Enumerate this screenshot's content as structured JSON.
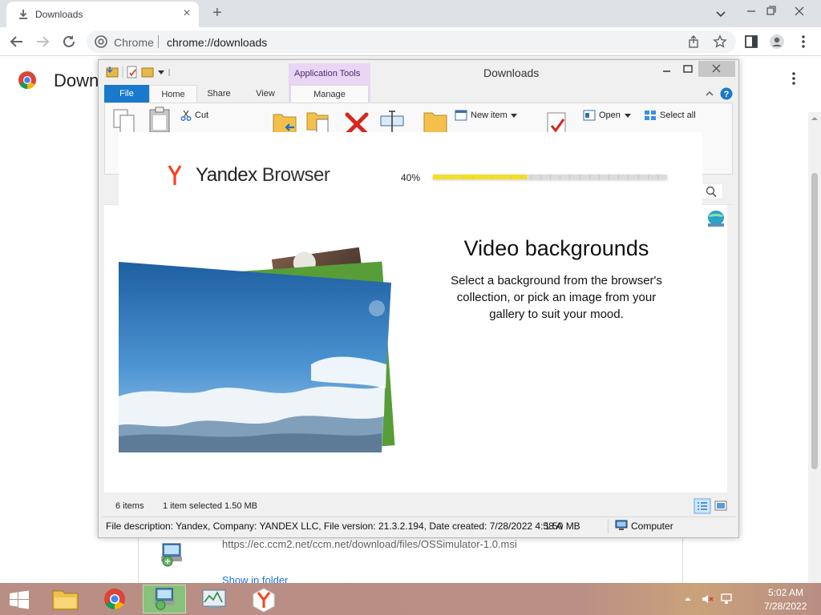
{
  "chrome": {
    "tab_title": "Downloads",
    "tab_close": "×",
    "new_tab": "+",
    "omnibox_site": "Chrome",
    "omnibox_url": "chrome://downloads",
    "page_title": "Down",
    "download_url": "https://ec.ccm2.net/ccm.net/download/files/OSSimulator-1.0.msi",
    "show_in_folder": "Show in folder"
  },
  "explorer": {
    "title": "Downloads",
    "application_tools": "Application Tools",
    "tabs": {
      "file": "File",
      "home": "Home",
      "share": "Share",
      "view": "View",
      "manage": "Manage"
    },
    "ribbon": {
      "cut": "Cut",
      "new_item": "New item",
      "open": "Open",
      "select_all": "Select all"
    },
    "status": {
      "items": "6 items",
      "selected": "1 item selected  1.50 MB"
    },
    "details": {
      "description": "File description: Yandex, Company: YANDEX LLC, File version: 21.3.2.194, Date created: 7/28/2022 4:58 A",
      "size": "1.50 MB",
      "location": "Computer"
    }
  },
  "installer": {
    "brand_main": "Yandex",
    "brand_light": " Browser",
    "progress_label": "40%",
    "progress_fraction": 0.4,
    "heading": "Video backgrounds",
    "body": "Select a background from the browser's collection, or pick an image from your gallery to suit your mood."
  },
  "taskbar": {
    "time": "5:02 AM",
    "date": "7/28/2022"
  },
  "colors": {
    "accent_blue": "#1979ca",
    "yandex_red": "#fc3f1d",
    "progress_yellow": "#f6e01b",
    "chrome_tab_strip": "#dee1e6"
  }
}
